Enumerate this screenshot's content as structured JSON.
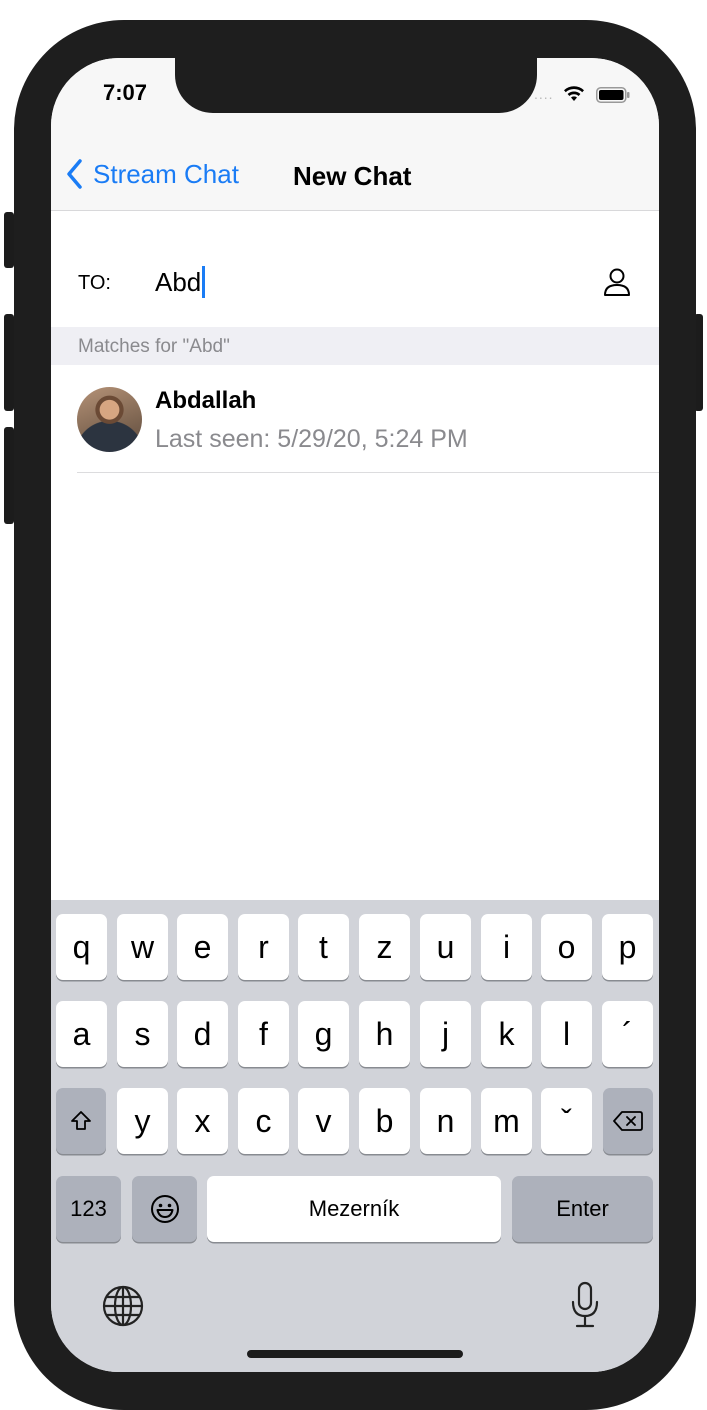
{
  "status_bar": {
    "time": "7:07",
    "signal": "....",
    "icons": [
      "wifi-icon",
      "battery-icon"
    ]
  },
  "nav": {
    "back_label": "Stream Chat",
    "title": "New Chat"
  },
  "recipient": {
    "to_label": "TO:",
    "input_value": "Abd",
    "icon": "person-icon"
  },
  "matches": {
    "header": "Matches for \"Abd\""
  },
  "users": [
    {
      "name": "Abdallah",
      "last_seen": "Last seen: 5/29/20, 5:24 PM"
    }
  ],
  "keyboard": {
    "row1": [
      "q",
      "w",
      "e",
      "r",
      "t",
      "z",
      "u",
      "i",
      "o",
      "p"
    ],
    "row2": [
      "a",
      "s",
      "d",
      "f",
      "g",
      "h",
      "j",
      "k",
      "l",
      "´"
    ],
    "row3": [
      "y",
      "x",
      "c",
      "v",
      "b",
      "n",
      "m",
      "ˇ"
    ],
    "numbers_key": "123",
    "space_key": "Mezerník",
    "enter_key": "Enter"
  },
  "colors": {
    "accent": "#1a7cf5",
    "secondary_text": "#8a8a8e",
    "keyboard_bg": "#d1d3d9"
  }
}
